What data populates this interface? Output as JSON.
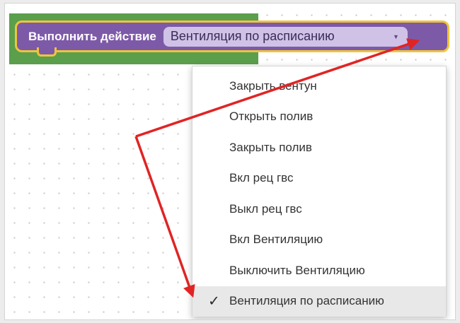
{
  "block": {
    "label": "Выполнить действие",
    "selected_value": "Вентиляция по расписанию",
    "caret": "▼"
  },
  "menu": {
    "check_glyph": "✓",
    "items": [
      {
        "label": "Закрыть вентун",
        "selected": false
      },
      {
        "label": "Открыть полив",
        "selected": false
      },
      {
        "label": "Закрыть полив",
        "selected": false
      },
      {
        "label": "Вкл рец гвс",
        "selected": false
      },
      {
        "label": "Выкл рец гвс",
        "selected": false
      },
      {
        "label": "Вкл Вентиляцию",
        "selected": false
      },
      {
        "label": "Выключить Вентиляцию",
        "selected": false
      },
      {
        "label": "Вентиляция по расписанию",
        "selected": true
      }
    ]
  },
  "colors": {
    "block_fill": "#7d5aa8",
    "block_border": "#f0c43a",
    "workspace_strip": "#5b9e4c",
    "arrow": "#e02424"
  }
}
